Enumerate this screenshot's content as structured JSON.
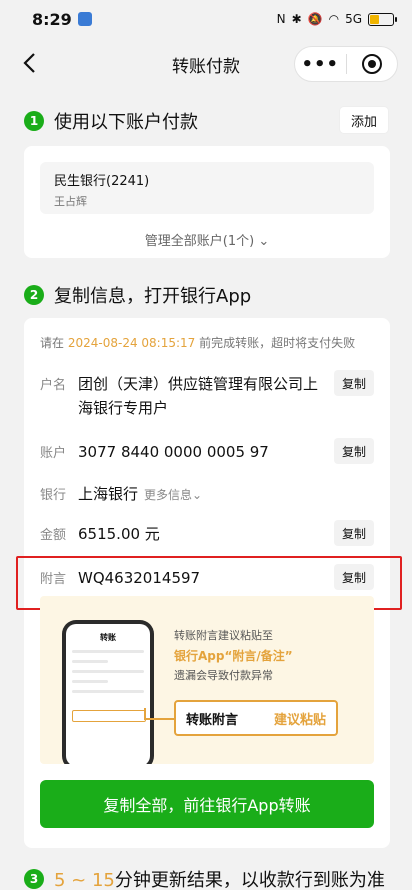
{
  "status_bar": {
    "time": "8:29",
    "icons": [
      "nfc-icon",
      "bluetooth-icon",
      "mute-icon",
      "wifi-icon",
      "signal-icon",
      "battery-icon"
    ],
    "network": "5G"
  },
  "nav": {
    "back_icon": "chevron-left-icon",
    "title": "转账付款",
    "more_label": "•••",
    "close_icon": "target-icon"
  },
  "step1": {
    "number": "1",
    "title": "使用以下账户付款",
    "add_label": "添加",
    "account": {
      "bank": "民生银行(2241)",
      "holder": "王占辉"
    },
    "manage_label": "管理全部账户(1个)",
    "manage_icon": "chevron-down-icon"
  },
  "step2": {
    "number": "2",
    "title": "复制信息，打开银行App",
    "deadline_prefix": "请在",
    "deadline_time": "2024-08-24 08:15:17",
    "deadline_suffix": "前完成转账，超时将支付失败",
    "fields": {
      "payee": {
        "label": "户名",
        "value": "团创（天津）供应链管理有限公司上海银行专用户",
        "copy": "复制"
      },
      "account": {
        "label": "账户",
        "value": "3077 8440 0000 0005 97",
        "copy": "复制"
      },
      "bank": {
        "label": "银行",
        "value": "上海银行",
        "more": "更多信息"
      },
      "amount": {
        "label": "金额",
        "value": "6515.00 元",
        "copy": "复制"
      },
      "memo": {
        "label": "附言",
        "value": "WQ4632014597",
        "copy": "复制"
      }
    },
    "tip": {
      "line1": "转账附言建议粘贴至",
      "line2": "银行App“附言/备注”",
      "line3": "遗漏会导致付款异常",
      "phone_title": "转账",
      "callout_label": "转账附言",
      "callout_action": "建议粘贴"
    },
    "primary_button": "复制全部，前往银行App转账"
  },
  "step3": {
    "number": "3",
    "title_accent": "5 ~ 15",
    "title_rest": "分钟更新结果，以收款行到账为准"
  },
  "colors": {
    "brand_green": "#1aad19",
    "accent_orange": "#e4a33c",
    "highlight_red": "#e02020"
  }
}
